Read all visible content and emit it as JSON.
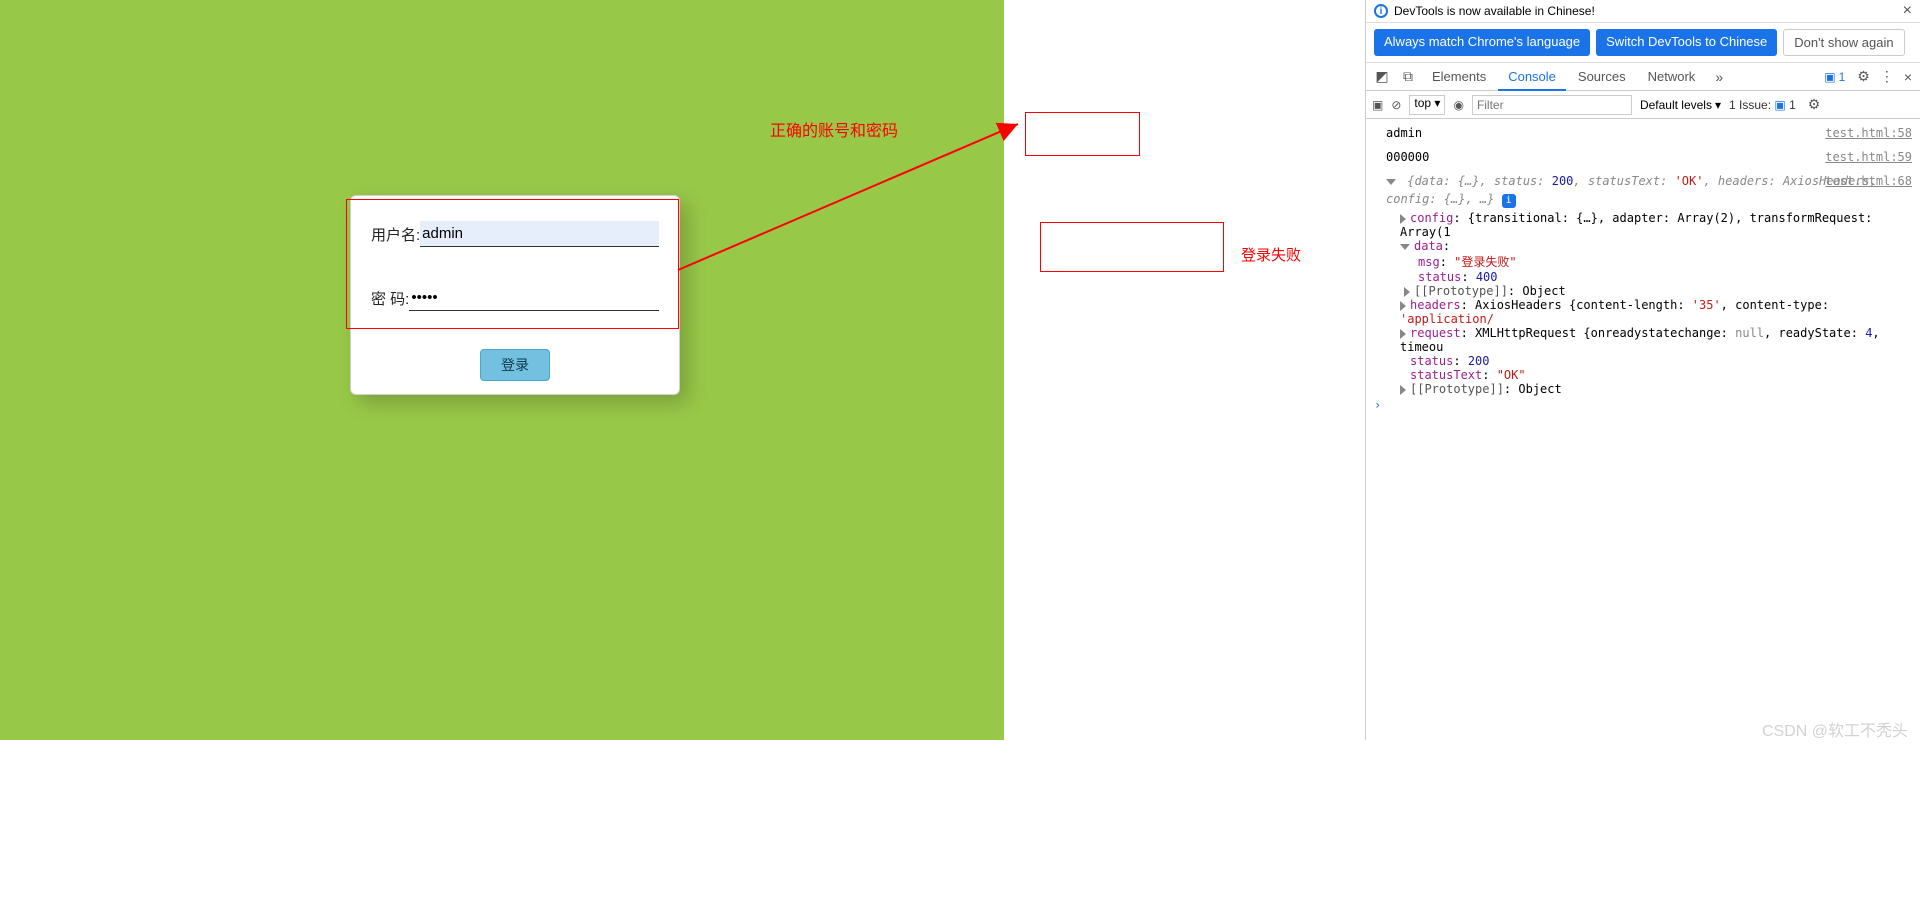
{
  "page": {
    "annotation1": "正确的账号和密码",
    "annotation2": "登录失败",
    "watermark": "CSDN @软工不秃头"
  },
  "login": {
    "username_label": "用户名:",
    "username_value": "admin",
    "password_label": "密 码:",
    "password_value": "•••••",
    "button_label": "登录"
  },
  "devtools": {
    "infobar_text": "DevTools is now available in Chinese!",
    "lang_btn1": "Always match Chrome's language",
    "lang_btn2": "Switch DevTools to Chinese",
    "lang_btn3": "Don't show again",
    "tabs": {
      "elements": "Elements",
      "console": "Console",
      "sources": "Sources",
      "network": "Network"
    },
    "errors_count": "1",
    "toolbar": {
      "context": "top",
      "filter_placeholder": "Filter",
      "levels": "Default levels",
      "issues_label": "1 Issue:",
      "issues_count": "1"
    },
    "console": {
      "line1": {
        "text": "admin",
        "src": "test.html:58"
      },
      "line2": {
        "text": "000000",
        "src": "test.html:59"
      },
      "src3": "test.html:68",
      "summary_pre": "{data: {…}, status: ",
      "summary_status": "200",
      "summary_mid": ", statusText: ",
      "summary_statusText": "'OK'",
      "summary_post": ", headers: AxiosHeaders, config: {…}, …}",
      "config_label": "config",
      "config_value": ": {transitional: {…}, adapter: Array(2), transformRequest: Array(1",
      "data_label": "data",
      "msg_label": "msg",
      "msg_value": "\"登录失败\"",
      "status_label": "status",
      "status_value": "400",
      "proto_label": "[[Prototype]]",
      "proto_value": ": Object",
      "headers_label": "headers",
      "headers_value_pre": ": AxiosHeaders {content-length: ",
      "headers_cl": "'35'",
      "headers_value_mid": ", content-type: ",
      "headers_ct": "'application/",
      "request_label": "request",
      "request_value_pre": ": XMLHttpRequest {onreadystatechange: ",
      "request_null": "null",
      "request_value_mid": ", readyState: ",
      "request_rs": "4",
      "request_value_post": ", timeou",
      "status2_label": "status",
      "status2_value": "200",
      "statusText_label": "statusText",
      "statusText_value": "\"OK\""
    }
  }
}
